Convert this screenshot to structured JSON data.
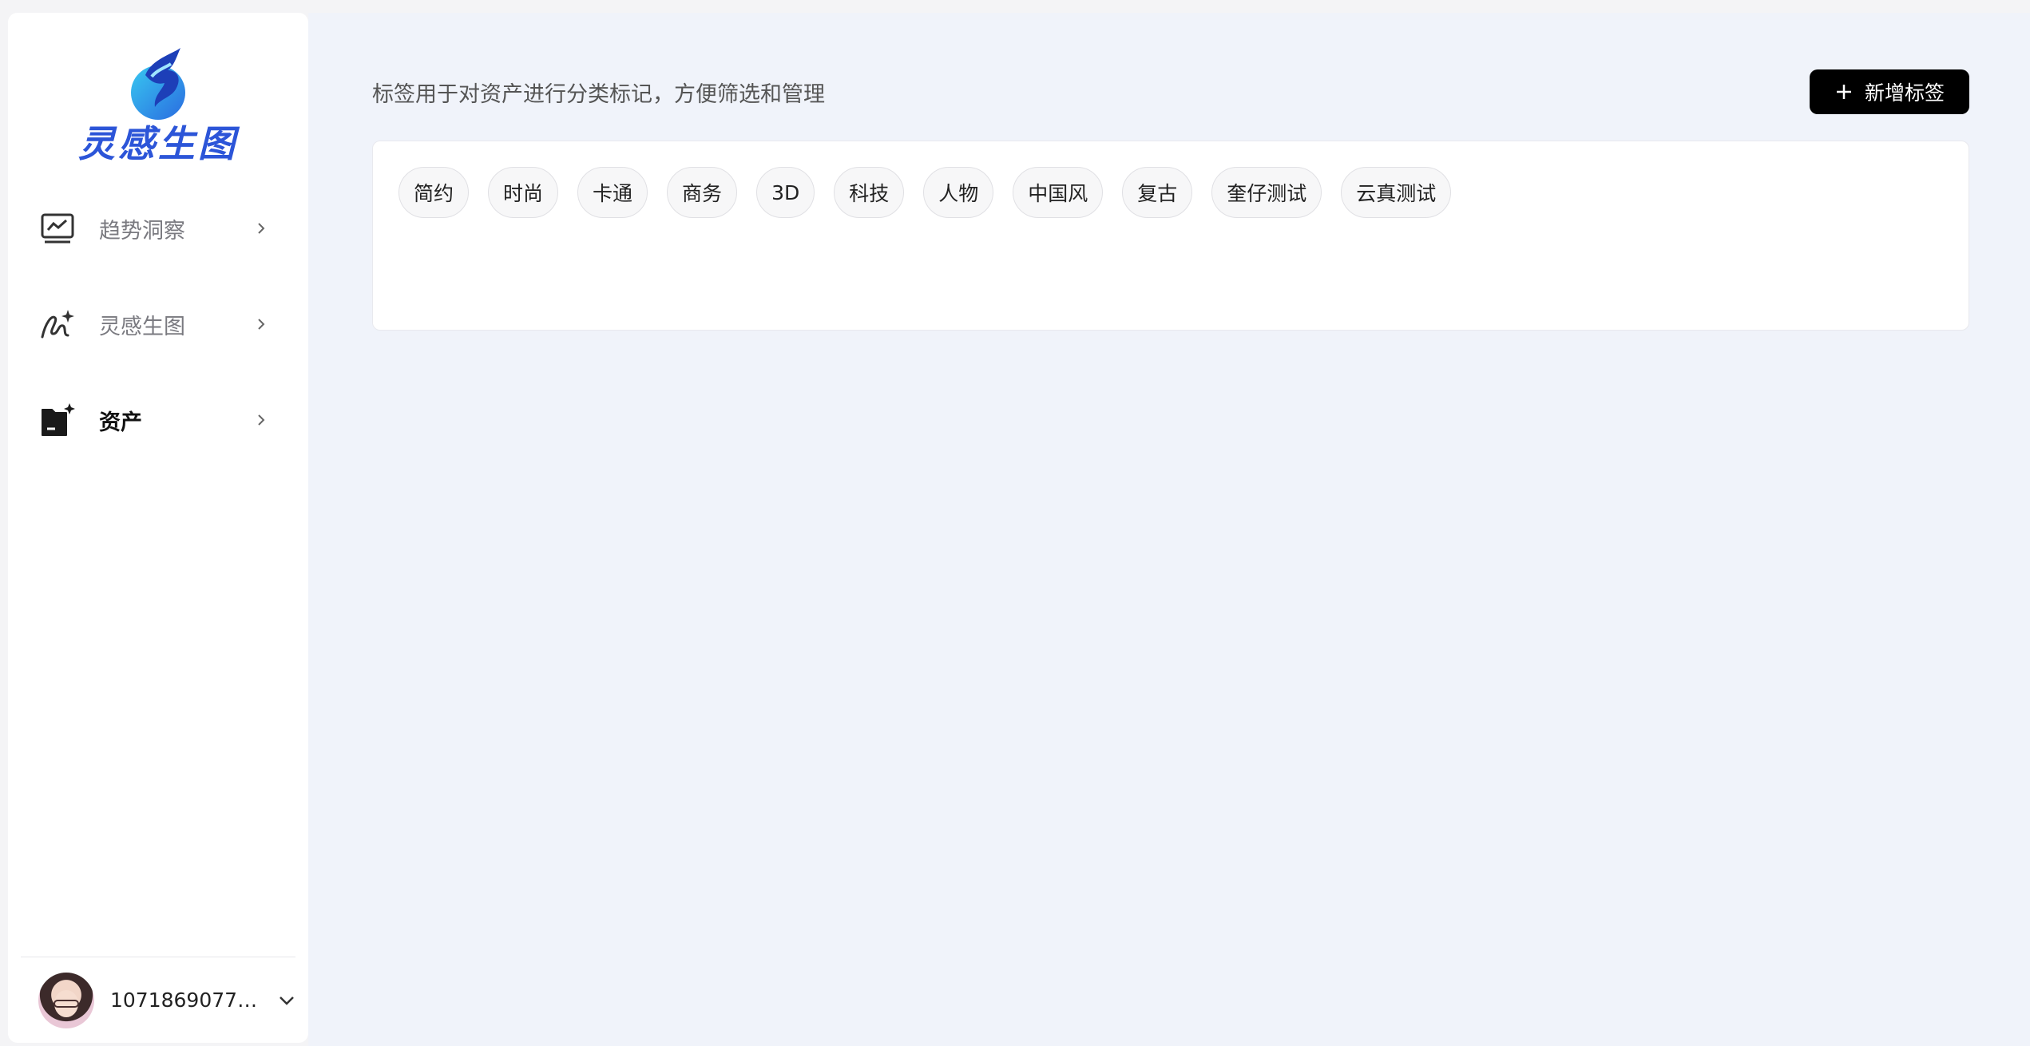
{
  "brand": {
    "name": "灵感生图"
  },
  "sidebar": {
    "items": [
      {
        "label": "趋势洞察",
        "icon": "trend-chart-icon",
        "active": false
      },
      {
        "label": "灵感生图",
        "icon": "magic-draw-icon",
        "active": false
      },
      {
        "label": "资产",
        "icon": "asset-folder-icon",
        "active": true
      }
    ]
  },
  "user": {
    "name": "10718690774..."
  },
  "main": {
    "description": "标签用于对资产进行分类标记，方便筛选和管理",
    "add_button_label": "新增标签",
    "tags": [
      "简约",
      "时尚",
      "卡通",
      "商务",
      "3D",
      "科技",
      "人物",
      "中国风",
      "复古",
      "奎仔测试",
      "云真测试"
    ]
  },
  "colors": {
    "brand_blue": "#2c55d8",
    "button_black": "#000000",
    "main_bg": "#f0f3fa"
  }
}
